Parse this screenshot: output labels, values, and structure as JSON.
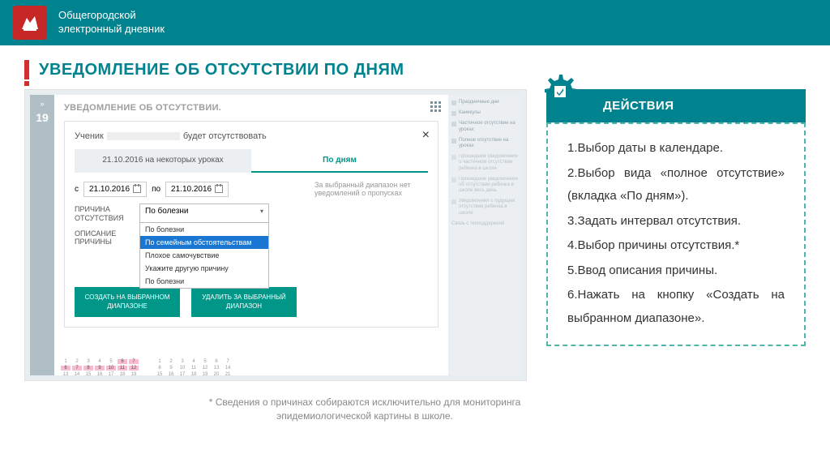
{
  "banner": {
    "line1": "Общегородской",
    "line2": "электронный дневник"
  },
  "title": "УВЕДОМЛЕНИЕ ОБ ОТСУТСТВИИ ПО ДНЯМ",
  "app": {
    "leftbar": {
      "arrow": "»",
      "day": "19"
    },
    "header": "УВЕДОМЛЕНИЕ ОБ ОТСУТСТВИИ.",
    "student_prefix": "Ученик",
    "student_suffix": "будет отсутствовать",
    "tabs": {
      "t1": "21.10.2016 на некоторых уроках",
      "t2": "По дням"
    },
    "date_from_lbl": "с",
    "date_from": "21.10.2016",
    "date_to_lbl": "по",
    "date_to": "21.10.2016",
    "hint": "За выбранный диапазон нет уведомлений о пропусках",
    "reason_lbl": "ПРИЧИНА ОТСУТСТВИЯ",
    "desc_lbl": "ОПИСАНИЕ ПРИЧИНЫ",
    "reason_selected": "По болезни",
    "reason_options": [
      "По болезни",
      "По семейным обстоятельствам",
      "Плохое самочувствие",
      "Укажите другую причину",
      "По болезни"
    ],
    "btn_create": "СОЗДАТЬ НА ВЫБРАННОМ ДИАПАЗОНЕ",
    "btn_delete": "УДАЛИТЬ ЗА ВЫБРАННЫЙ ДИАПАЗОН",
    "legend": [
      "Праздничные дни",
      "Каникулы",
      "Частичное отсутствие на уроках",
      "Полное отсутствие на уроках",
      "Прошедшие уведомления о частичном отсутствии ребенка в школе",
      "Прошедшие уведомления об отсутствии ребенка в школе весь день",
      "Уведомления о будущем отсутствии ребенка в школе",
      "Связь с техподдержкой"
    ]
  },
  "actions": {
    "head": "ДЕЙСТВИЯ",
    "steps": [
      "1.Выбор даты в календаре.",
      "2.Выбор вида «полное отсутствие» (вкладка «По дням»).",
      "3.Задать интервал отсутствия.",
      "4.Выбор причины отсутствия.*",
      "5.Ввод описания причины.",
      "6.Нажать на кнопку «Создать на выбранном диапазоне»."
    ]
  },
  "footnote": "* Сведения о причинах собираются исключительно для мониторинга эпидемиологической картины в школе."
}
